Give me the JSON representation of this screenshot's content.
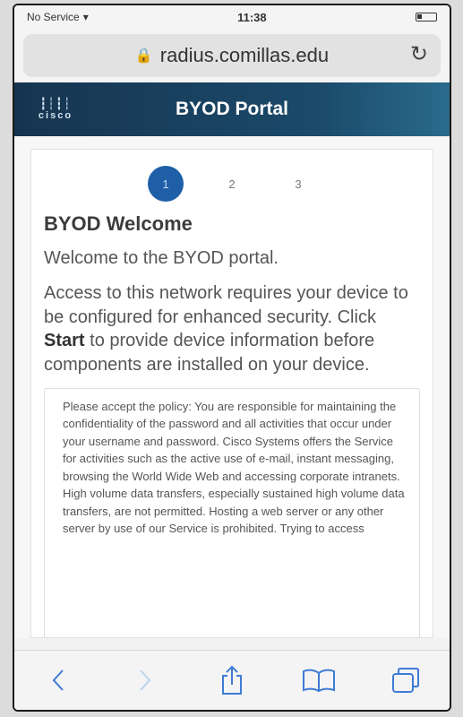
{
  "status_bar": {
    "carrier": "No Service",
    "time": "11:38"
  },
  "browser": {
    "url": "radius.comillas.edu"
  },
  "header": {
    "logo_text": "cisco",
    "title": "BYOD Portal"
  },
  "steps": [
    "1",
    "2",
    "3"
  ],
  "main": {
    "heading": "BYOD Welcome",
    "welcome_text": "Welcome to the BYOD portal.",
    "access_before": "Access to this network requires your device to be configured for enhanced security. Click",
    "access_bold": "Start",
    "access_after": "to provide device information before components are installed on your device.",
    "policy_text": "Please accept the policy: You are responsible for maintaining the confidentiality of the password and all activities that occur under your username and password. Cisco Systems offers the Service for activities such as the active use of e-mail, instant messaging, browsing the World Wide Web and accessing corporate intranets. High volume data transfers, especially sustained high volume data transfers, are not permitted. Hosting a web server or any other server by use of our Service is prohibited. Trying to access"
  },
  "toolbar": {
    "icons": [
      "back-icon",
      "forward-icon",
      "share-icon",
      "bookmarks-icon",
      "tabs-icon"
    ]
  },
  "colors": {
    "header_bg": "#16344f",
    "step_active": "#1f5fa8",
    "toolbar_icon": "#3d7bd6"
  }
}
